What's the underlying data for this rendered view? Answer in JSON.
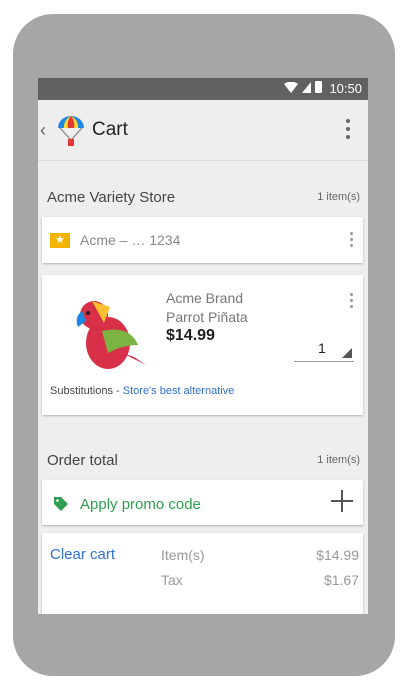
{
  "status_bar": {
    "time": "10:50"
  },
  "app_bar": {
    "title": "Cart"
  },
  "store": {
    "name": "Acme Variety Store",
    "count": "1 item(s)",
    "account": "Acme – … 1234",
    "badge": "★"
  },
  "product": {
    "brand_line1": "Acme Brand",
    "brand_line2": "Parrot Piñata",
    "price": "$14.99",
    "quantity": "1",
    "subs_label": "Substitutions - ",
    "subs_value": "Store's best alternative"
  },
  "order": {
    "label": "Order total",
    "count": "1 item(s)"
  },
  "promo": {
    "label": "Apply promo code"
  },
  "totals": {
    "clear_label": "Clear cart",
    "rows": [
      {
        "label": "Item(s)",
        "value": "$14.99"
      },
      {
        "label": "Tax",
        "value": "$1.67"
      }
    ]
  },
  "colors": {
    "accent_blue": "#2f6fd6",
    "promo_green": "#2e9e4f",
    "badge_yellow": "#f2b400",
    "status_bar": "#616161"
  }
}
